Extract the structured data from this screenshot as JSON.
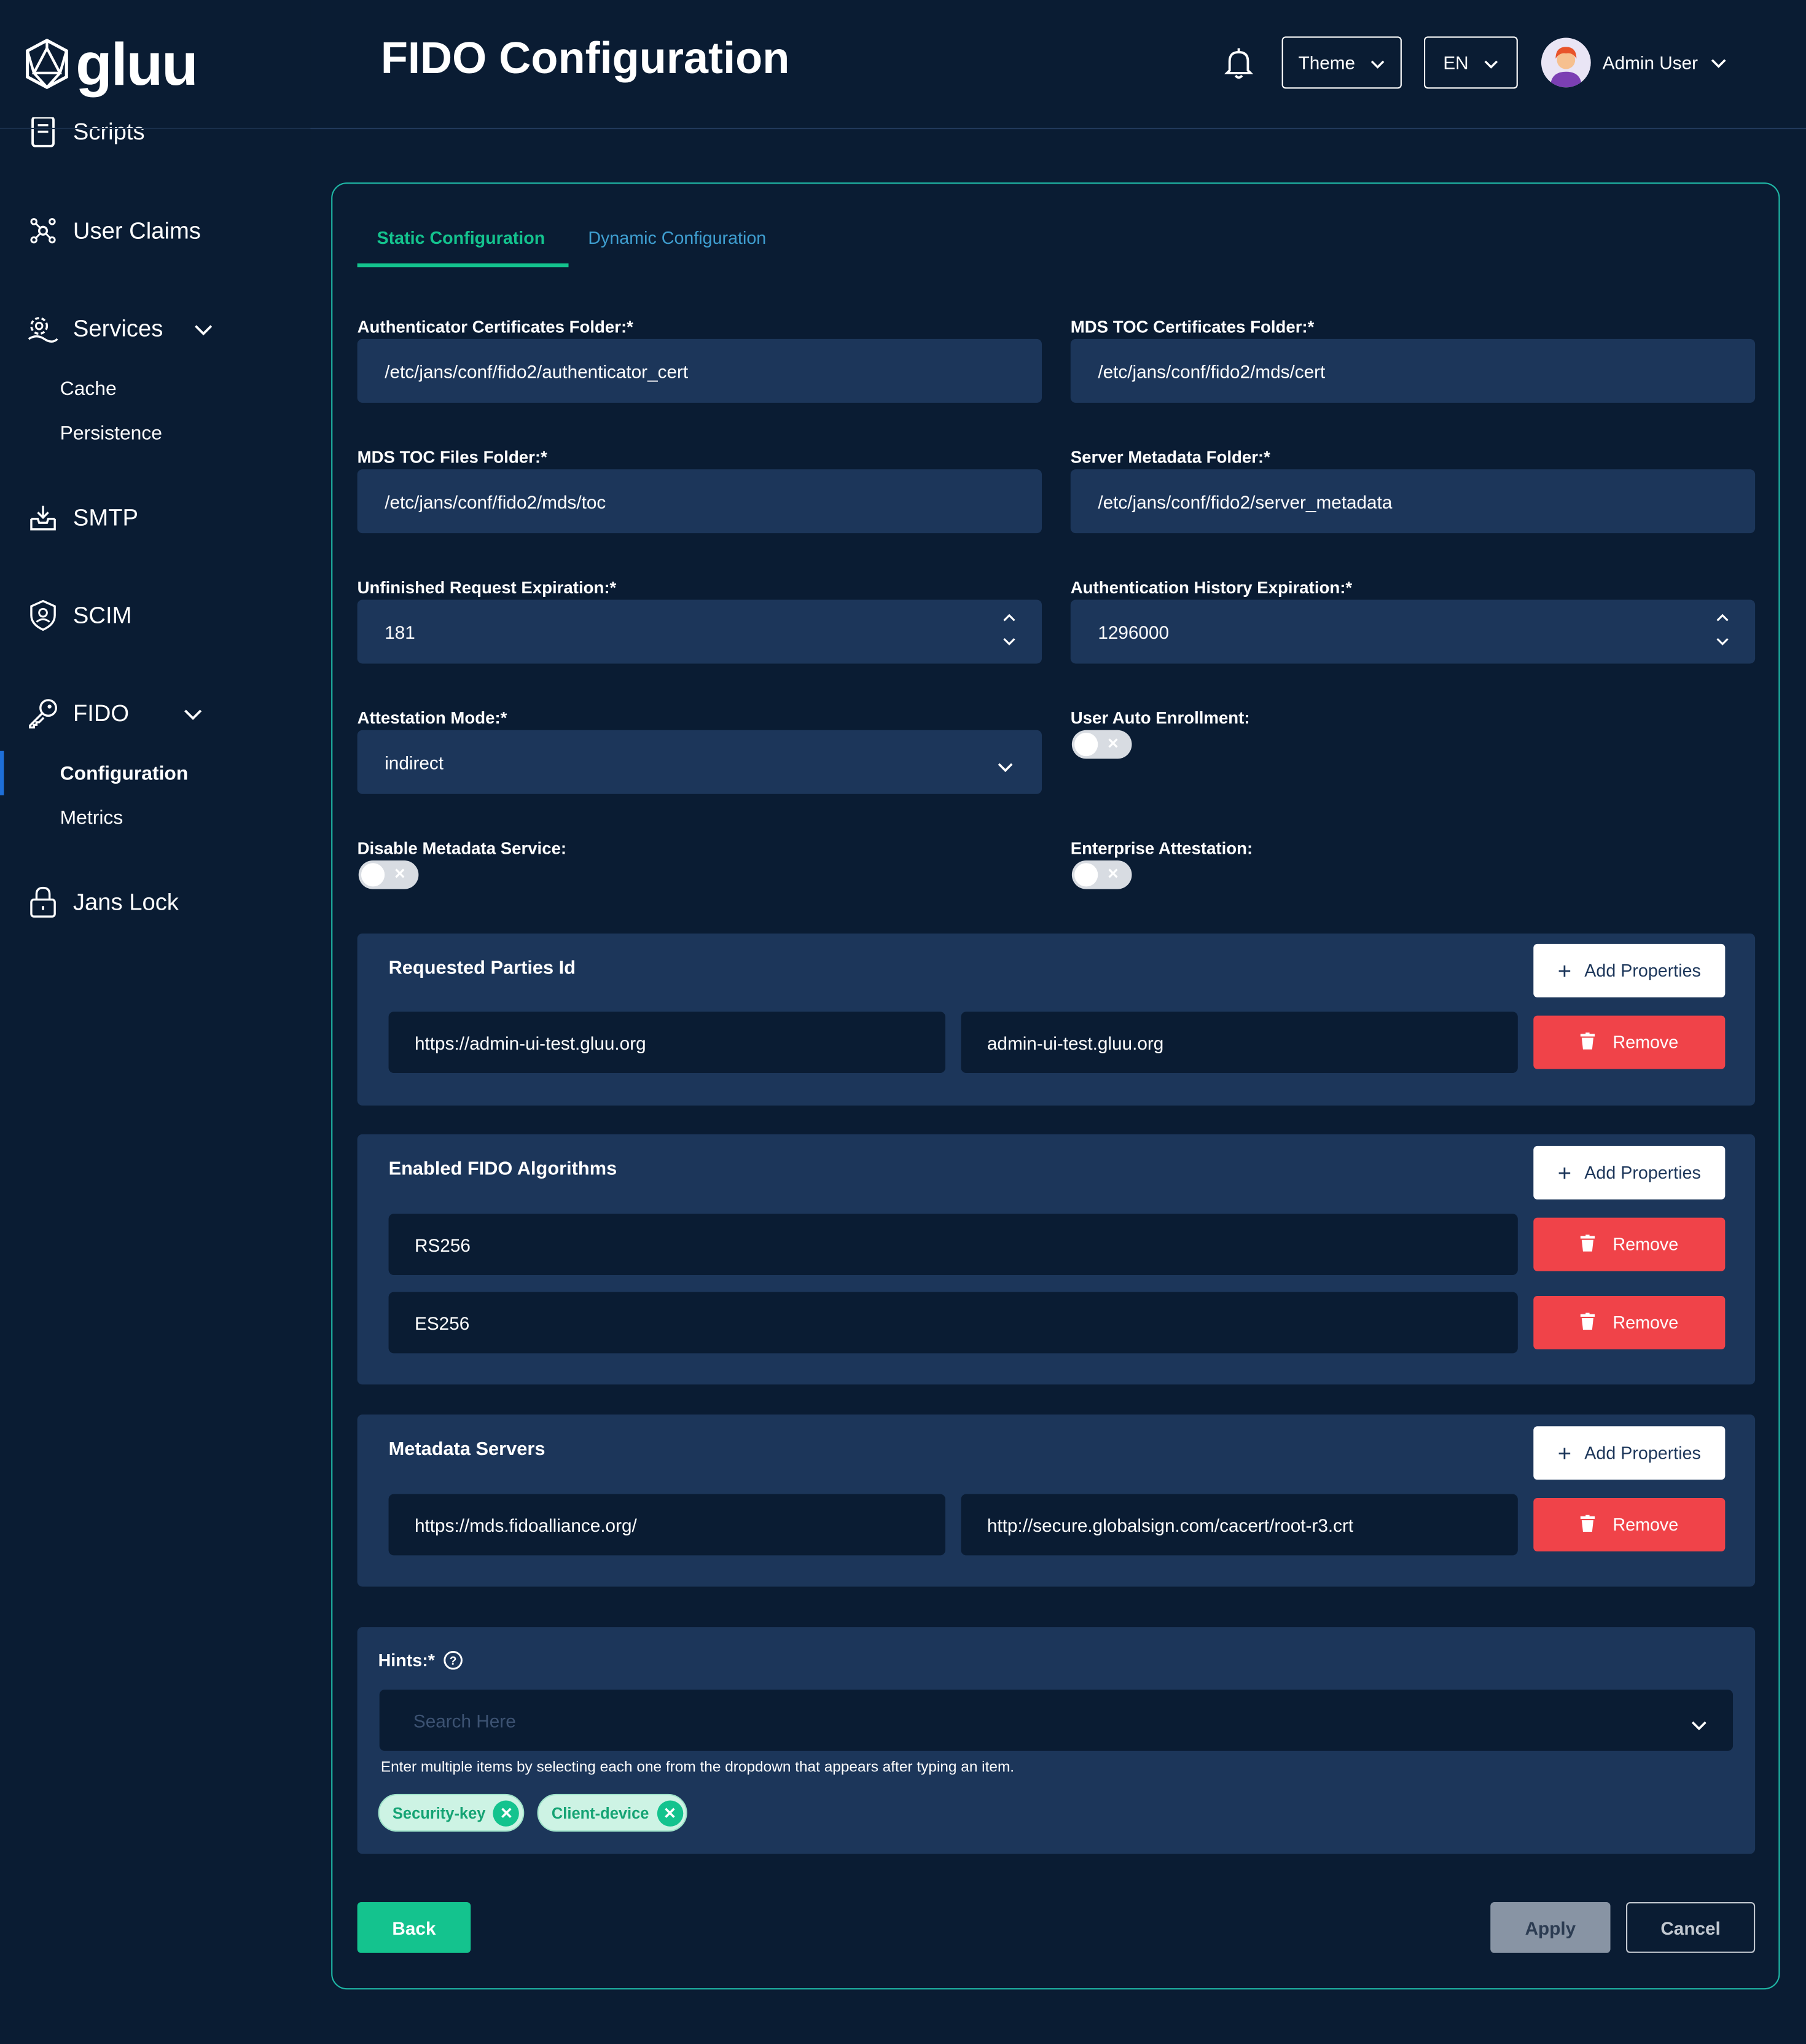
{
  "app": {
    "logo_text": "gluu",
    "page_title": "FIDO Configuration"
  },
  "header": {
    "theme_label": "Theme",
    "lang_label": "EN",
    "user_name": "Admin User"
  },
  "sidebar": {
    "items": [
      {
        "label": "Scripts",
        "icon": "scroll-icon"
      },
      {
        "label": "User Claims",
        "icon": "claims-icon"
      },
      {
        "label": "Services",
        "icon": "services-icon"
      },
      {
        "label": "SMTP",
        "icon": "inbox-icon"
      },
      {
        "label": "SCIM",
        "icon": "shield-user-icon"
      },
      {
        "label": "FIDO",
        "icon": "key-icon"
      },
      {
        "label": "Jans Lock",
        "icon": "lock-icon"
      }
    ],
    "services_sub": [
      "Cache",
      "Persistence"
    ],
    "fido_sub": [
      "Configuration",
      "Metrics"
    ]
  },
  "tabs": [
    "Static Configuration",
    "Dynamic Configuration"
  ],
  "form": {
    "auth_cert_folder": {
      "label": "Authenticator Certificates Folder:*",
      "value": "/etc/jans/conf/fido2/authenticator_cert"
    },
    "mds_toc_cert_folder": {
      "label": "MDS TOC Certificates Folder:*",
      "value": "/etc/jans/conf/fido2/mds/cert"
    },
    "mds_toc_files_folder": {
      "label": "MDS TOC Files Folder:*",
      "value": "/etc/jans/conf/fido2/mds/toc"
    },
    "server_metadata_folder": {
      "label": "Server Metadata Folder:*",
      "value": "/etc/jans/conf/fido2/server_metadata"
    },
    "unfinished_req_exp": {
      "label": "Unfinished Request Expiration:*",
      "value": "181"
    },
    "auth_history_exp": {
      "label": "Authentication History Expiration:*",
      "value": "1296000"
    },
    "attestation_mode": {
      "label": "Attestation Mode:*",
      "value": "indirect"
    },
    "user_auto_enrollment": {
      "label": "User Auto Enrollment:",
      "enabled": false
    },
    "disable_metadata_service": {
      "label": "Disable Metadata Service:",
      "enabled": false
    },
    "enterprise_attestation": {
      "label": "Enterprise Attestation:",
      "enabled": false
    }
  },
  "requested_parties": {
    "title": "Requested Parties Id",
    "rows": [
      {
        "key": "https://admin-ui-test.gluu.org",
        "value": "admin-ui-test.gluu.org"
      }
    ]
  },
  "algorithms": {
    "title": "Enabled FIDO Algorithms",
    "rows": [
      "RS256",
      "ES256"
    ]
  },
  "metadata_servers": {
    "title": "Metadata Servers",
    "rows": [
      {
        "key": "https://mds.fidoalliance.org/",
        "value": "http://secure.globalsign.com/cacert/root-r3.crt"
      }
    ]
  },
  "buttons": {
    "add_properties": "Add Properties",
    "remove": "Remove",
    "back": "Back",
    "apply": "Apply",
    "cancel": "Cancel"
  },
  "hints": {
    "label": "Hints:*",
    "placeholder": "Search Here",
    "help_text": "Enter multiple items by selecting each one from the dropdown that appears after typing an item.",
    "chips": [
      "Security-key",
      "Client-device"
    ]
  },
  "colors": {
    "background": "#0a1c33",
    "field": "#1c365a",
    "accent": "#14c38e",
    "danger": "#f04349",
    "border": "#1fb8a6"
  }
}
